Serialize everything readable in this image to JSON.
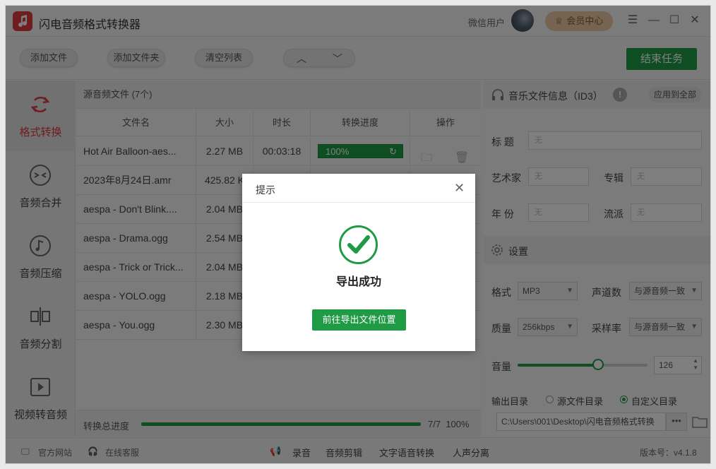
{
  "app": {
    "title": "闪电音频格式转换器"
  },
  "header": {
    "user_name": "微信用户",
    "vip_label": "会员中心"
  },
  "toolbar": {
    "add_file": "添加文件",
    "add_folder": "添加文件夹",
    "clear_list": "清空列表",
    "end_task": "结束任务"
  },
  "sidebar": {
    "items": [
      {
        "label": "格式转换"
      },
      {
        "label": "音频合并"
      },
      {
        "label": "音频压缩"
      },
      {
        "label": "音频分割"
      },
      {
        "label": "视频转音频"
      }
    ]
  },
  "files": {
    "header": "源音频文件 (7个)",
    "columns": [
      "文件名",
      "大小",
      "时长",
      "转换进度",
      "操作"
    ],
    "rows": [
      {
        "name": "Hot Air Balloon-aes...",
        "size": "2.27 MB",
        "duration": "00:03:18",
        "progress": "100%"
      },
      {
        "name": "2023年8月24日.amr",
        "size": "425.82 K",
        "duration": "",
        "progress": ""
      },
      {
        "name": "aespa - Don't Blink....",
        "size": "2.04 MB",
        "duration": "",
        "progress": ""
      },
      {
        "name": "aespa - Drama.ogg",
        "size": "2.54 MB",
        "duration": "",
        "progress": ""
      },
      {
        "name": "aespa - Trick or Trick...",
        "size": "2.04 MB",
        "duration": "",
        "progress": ""
      },
      {
        "name": "aespa - YOLO.ogg",
        "size": "2.18 MB",
        "duration": "",
        "progress": ""
      },
      {
        "name": "aespa - You.ogg",
        "size": "2.30 MB",
        "duration": "",
        "progress": ""
      }
    ],
    "total_label": "转换总进度",
    "total_count": "7/7",
    "total_percent": "100%",
    "total_fraction": 1.0
  },
  "id3": {
    "header": "音乐文件信息（ID3）",
    "apply_all": "应用到全部",
    "title_label": "标 题",
    "artist_label": "艺术家",
    "album_label": "专辑",
    "year_label": "年 份",
    "genre_label": "流派",
    "placeholder": "无"
  },
  "settings": {
    "header": "设置",
    "format_label": "格式",
    "format_value": "MP3",
    "channels_label": "声道数",
    "channels_value": "与源音频一致",
    "quality_label": "质量",
    "quality_value": "256kbps",
    "samplerate_label": "采样率",
    "samplerate_value": "与源音频一致",
    "volume_label": "音量",
    "volume_value": "126",
    "output_label": "输出目录",
    "opt_source": "源文件目录",
    "opt_custom": "自定义目录",
    "output_path": "C:\\Users\\001\\Desktop\\闪电音频格式转换"
  },
  "footer": {
    "website": "官方网站",
    "support": "在线客服",
    "record": "录音",
    "audio_edit": "音频剪辑",
    "tts": "文字语音转换",
    "vocal_sep": "人声分离",
    "version": "版本号：v4.1.8"
  },
  "dialog": {
    "title": "提示",
    "message": "导出成功",
    "button": "前往导出文件位置"
  },
  "colors": {
    "accent": "#1f9b45",
    "brand": "#e03a3f"
  }
}
